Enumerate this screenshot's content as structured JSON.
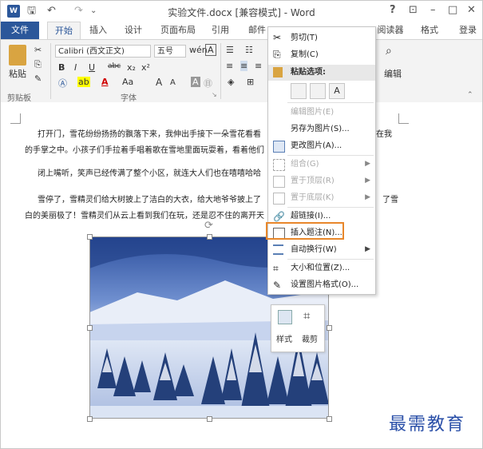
{
  "window": {
    "title": "实验文件.docx [兼容模式] - Word",
    "help": "?",
    "ribbon_display": "⊡",
    "minimize": "–",
    "maximize": "□",
    "close": "✕"
  },
  "quick_access": {
    "save": "🖫",
    "undo": "↶",
    "redo": "↷",
    "customize": "⌄"
  },
  "tabs": {
    "file": "文件",
    "home": "开始",
    "insert": "插入",
    "design": "设计",
    "layout": "页面布局",
    "references": "引用",
    "mailings": "邮件",
    "reader": "阅读器",
    "format": "格式",
    "login": "登录"
  },
  "ribbon": {
    "clipboard": {
      "paste": "粘贴",
      "label": "剪贴板"
    },
    "font": {
      "name": "Calibri (西文正文)",
      "size": "五号",
      "label": "字体",
      "bold": "B",
      "italic": "I",
      "underline": "U",
      "strike": "abc",
      "sub": "x₂",
      "sup": "x²",
      "grow": "A",
      "shrink": "A",
      "case": "Aa",
      "clear": "A"
    },
    "editing": {
      "label": "编辑"
    }
  },
  "document": {
    "para1_line1": "打开门，雪花纷纷扬扬的飘落下来，我伸出手接下一朵雪花看看",
    "para1_line1_tail": "在我",
    "para1_line2": "的手掌之中。小孩子们手拉着手唱着歌在雪地里面玩耍着，看着他们",
    "para2": "闭上嘴听，笑声已经传满了整个小区，就连大人们也在嘻嘻哈哈",
    "para3_line1": "雪停了，雪精灵们给大树披上了洁白的大衣，给大地爷爷披上了",
    "para3_line1_tail": "了雪",
    "para3_line2": "白的美丽极了！雪精灵们从云上看到我们在玩，还是忍不住的离开天"
  },
  "context_menu": {
    "cut": "剪切(T)",
    "copy": "复制(C)",
    "paste_options": "粘贴选项:",
    "edit_picture": "编辑图片(E)",
    "save_as_picture": "另存为图片(S)...",
    "change_picture": "更改图片(A)...",
    "group": "组合(G)",
    "bring_front": "置于顶层(R)",
    "send_back": "置于底层(K)",
    "hyperlink": "超链接(I)...",
    "insert_caption": "插入题注(N)...",
    "wrap_text": "自动换行(W)",
    "size_position": "大小和位置(Z)...",
    "format_picture": "设置图片格式(O)..."
  },
  "mini_toolbar": {
    "style": "样式",
    "crop": "裁剪"
  },
  "watermark": "最需教育",
  "colors": {
    "accent": "#2b579a",
    "highlight_border": "#e8872b",
    "watermark": "#2a4fa8"
  }
}
